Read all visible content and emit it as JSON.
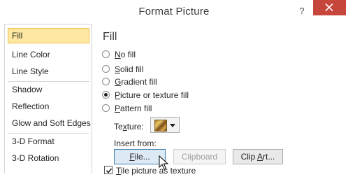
{
  "window": {
    "title": "Format Picture",
    "help_label": "?",
    "close_label": "close"
  },
  "nav": {
    "items": [
      {
        "label": "Fill",
        "selected": true
      },
      {
        "label": "Line Color"
      },
      {
        "label": "Line Style"
      },
      {
        "label": "Shadow"
      },
      {
        "label": "Reflection"
      },
      {
        "label": "Glow and Soft Edges"
      },
      {
        "label": "3-D Format"
      },
      {
        "label": "3-D Rotation"
      }
    ]
  },
  "fill": {
    "title": "Fill",
    "options": [
      {
        "mnemonic": "N",
        "rest": "o fill",
        "checked": false
      },
      {
        "mnemonic": "S",
        "rest": "olid fill",
        "checked": false
      },
      {
        "mnemonic": "G",
        "rest": "radient fill",
        "checked": false
      },
      {
        "mnemonic": "P",
        "rest": "icture or texture fill",
        "checked": true
      },
      {
        "mnemonic": "P",
        "rest": "attern fill",
        "checked": false
      }
    ],
    "texture_label_pre": "Te",
    "texture_label_mn": "x",
    "texture_label_post": "ture:",
    "insert_from_label": "Insert from:",
    "file_button_pre": "F",
    "file_button_post": "ile...",
    "clipboard_button": "Clipboard",
    "clipart_button_pre": "Clip ",
    "clipart_button_mn": "A",
    "clipart_button_post": "rt...",
    "tile_checkbox_mn": "T",
    "tile_checkbox_rest": "ile picture as texture",
    "tile_checked": true
  },
  "icons": {
    "close": "close-icon",
    "texture": "texture-swatch-icon",
    "dropdown": "chevron-down-icon",
    "cursor": "mouse-pointer-icon"
  },
  "colors": {
    "close_button": "#c7463c",
    "nav_selected": "#fde7a1",
    "focus_border": "#3c7fb1"
  }
}
